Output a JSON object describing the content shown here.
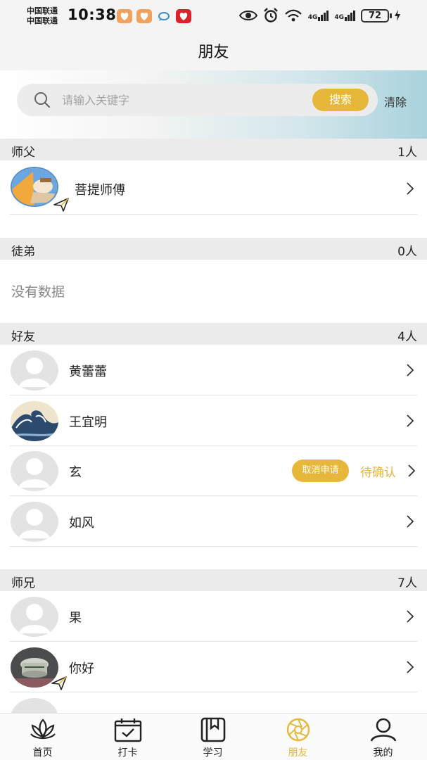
{
  "status_bar": {
    "carrier_1": "中国联通",
    "carrier_2": "中国联通",
    "time": "10:38",
    "battery": "72",
    "network_1": "4G",
    "network_2": "4G"
  },
  "header": {
    "title": "朋友"
  },
  "search": {
    "placeholder": "请输入关键字",
    "value": "",
    "search_label": "搜索",
    "clear_label": "清除"
  },
  "sections": {
    "master": {
      "title": "师父",
      "count": "1人",
      "items": [
        {
          "name": "菩提师傅",
          "avatar": "landscape-photo",
          "badge": "paper-plane-icon"
        }
      ]
    },
    "disciple": {
      "title": "徒弟",
      "count": "0人",
      "empty_text": "没有数据"
    },
    "friends": {
      "title": "好友",
      "count": "4人",
      "items": [
        {
          "name": "黄蕾蕾",
          "avatar": "default-avatar"
        },
        {
          "name": "王宜明",
          "avatar": "great-wave-image"
        },
        {
          "name": "玄",
          "avatar": "default-avatar",
          "action_label": "取消申请",
          "status": "待确认"
        },
        {
          "name": "如风",
          "avatar": "default-avatar"
        }
      ]
    },
    "senior": {
      "title": "师兄",
      "count": "7人",
      "items": [
        {
          "name": "果",
          "avatar": "default-avatar"
        },
        {
          "name": "你好",
          "avatar": "incense-burner-photo",
          "badge": "paper-plane-icon"
        }
      ]
    }
  },
  "tabs": [
    {
      "label": "首页",
      "icon": "lotus-icon"
    },
    {
      "label": "打卡",
      "icon": "calendar-check-icon"
    },
    {
      "label": "学习",
      "icon": "book-icon"
    },
    {
      "label": "朋友",
      "icon": "aperture-icon",
      "active": true
    },
    {
      "label": "我的",
      "icon": "person-icon"
    }
  ],
  "colors": {
    "accent": "#e6b73a",
    "section_header_bg": "#ebebeb",
    "avatar_placeholder": "#e3e3e3"
  }
}
